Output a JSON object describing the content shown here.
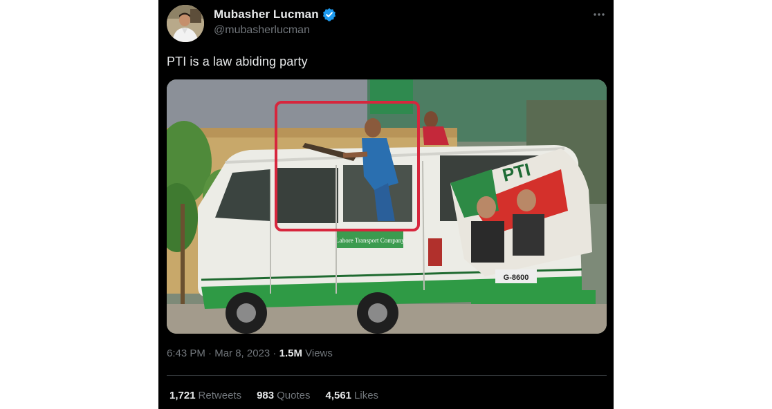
{
  "tweet": {
    "author": {
      "name": "Mubasher Lucman",
      "handle": "@mubasherlucman",
      "verified_icon": "verified-badge-icon",
      "avatar_icon": "avatar"
    },
    "text": "PTI is a law abiding party",
    "media": {
      "photo_signs": {
        "van_side_label": "Lahore Transport Company",
        "poster_text": "PTI",
        "plate": "G-8600"
      }
    },
    "meta": {
      "time": "6:43 PM",
      "separator": " · ",
      "date": "Mar 8, 2023",
      "views_count": "1.5M",
      "views_label": "Views"
    },
    "stats": {
      "retweets_count": "1,721",
      "retweets_label": "Retweets",
      "quotes_count": "983",
      "quotes_label": "Quotes",
      "likes_count": "4,561",
      "likes_label": "Likes"
    },
    "more_menu_icon": "more-horizontal-icon",
    "colors": {
      "background": "#000000",
      "text_primary": "#e7e9ea",
      "text_secondary": "#71767b",
      "divider": "#2f3336",
      "verified_blue": "#1d9bf0",
      "highlight_box": "#d7263d"
    }
  }
}
